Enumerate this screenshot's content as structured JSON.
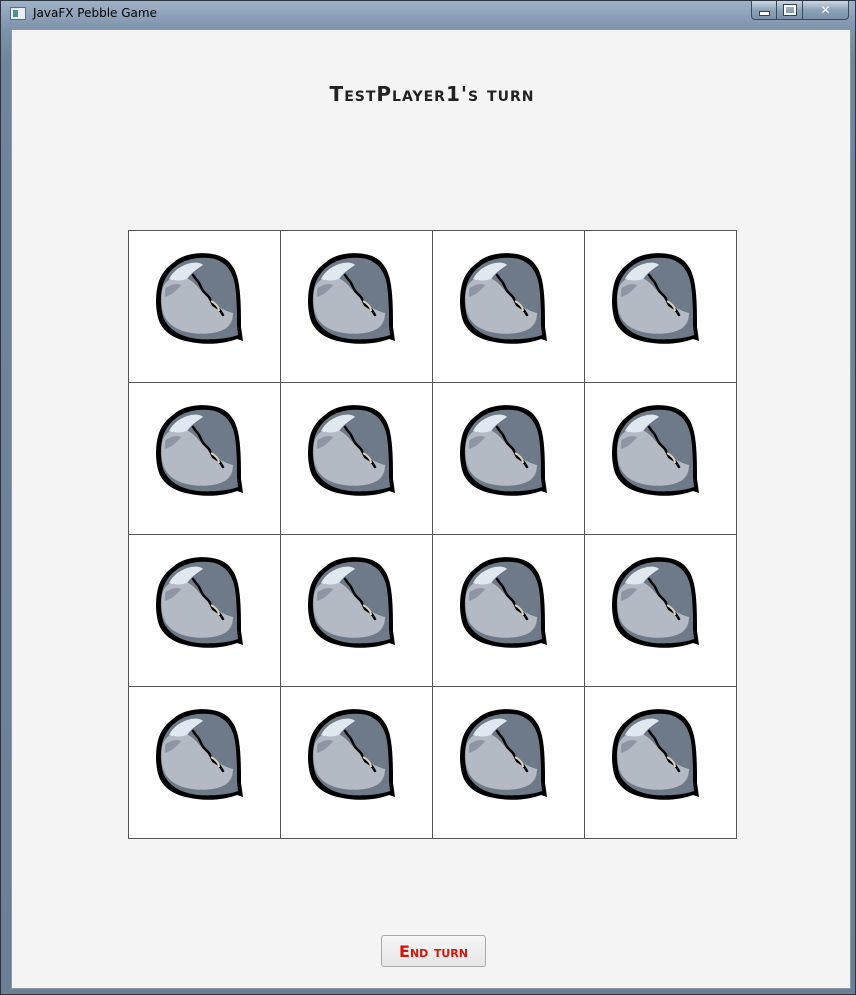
{
  "window": {
    "title": "JavaFX Pebble Game",
    "controls": {
      "minimize": "minimize",
      "maximize": "maximize",
      "close": "close"
    }
  },
  "game": {
    "turn_label": "TestPlayer1's turn",
    "board": {
      "rows": 4,
      "cols": 4,
      "cells": [
        {
          "row": 1,
          "col": 1,
          "content": "pebble"
        },
        {
          "row": 1,
          "col": 2,
          "content": "pebble"
        },
        {
          "row": 1,
          "col": 3,
          "content": "pebble"
        },
        {
          "row": 1,
          "col": 4,
          "content": "pebble"
        },
        {
          "row": 2,
          "col": 1,
          "content": "pebble"
        },
        {
          "row": 2,
          "col": 2,
          "content": "pebble"
        },
        {
          "row": 2,
          "col": 3,
          "content": "pebble"
        },
        {
          "row": 2,
          "col": 4,
          "content": "pebble"
        },
        {
          "row": 3,
          "col": 1,
          "content": "pebble"
        },
        {
          "row": 3,
          "col": 2,
          "content": "pebble"
        },
        {
          "row": 3,
          "col": 3,
          "content": "pebble"
        },
        {
          "row": 3,
          "col": 4,
          "content": "pebble"
        },
        {
          "row": 4,
          "col": 1,
          "content": "pebble"
        },
        {
          "row": 4,
          "col": 2,
          "content": "pebble"
        },
        {
          "row": 4,
          "col": 3,
          "content": "pebble"
        },
        {
          "row": 4,
          "col": 4,
          "content": "pebble"
        }
      ]
    },
    "end_turn_label": "End turn"
  },
  "colors": {
    "end_turn_text": "#d2140a",
    "pebble_light": "#b4bac4",
    "pebble_dark": "#6e7a88",
    "pebble_highlight": "#dfe7ef"
  }
}
